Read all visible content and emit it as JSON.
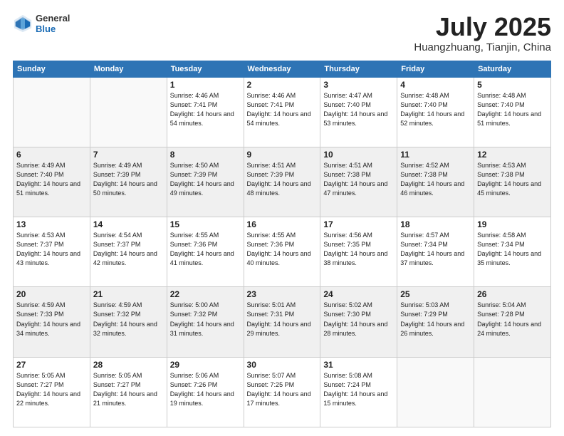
{
  "logo": {
    "general": "General",
    "blue": "Blue"
  },
  "title": {
    "month": "July 2025",
    "location": "Huangzhuang, Tianjin, China"
  },
  "weekdays": [
    "Sunday",
    "Monday",
    "Tuesday",
    "Wednesday",
    "Thursday",
    "Friday",
    "Saturday"
  ],
  "weeks": [
    [
      {
        "day": "",
        "info": ""
      },
      {
        "day": "",
        "info": ""
      },
      {
        "day": "1",
        "info": "Sunrise: 4:46 AM\nSunset: 7:41 PM\nDaylight: 14 hours and 54 minutes."
      },
      {
        "day": "2",
        "info": "Sunrise: 4:46 AM\nSunset: 7:41 PM\nDaylight: 14 hours and 54 minutes."
      },
      {
        "day": "3",
        "info": "Sunrise: 4:47 AM\nSunset: 7:40 PM\nDaylight: 14 hours and 53 minutes."
      },
      {
        "day": "4",
        "info": "Sunrise: 4:48 AM\nSunset: 7:40 PM\nDaylight: 14 hours and 52 minutes."
      },
      {
        "day": "5",
        "info": "Sunrise: 4:48 AM\nSunset: 7:40 PM\nDaylight: 14 hours and 51 minutes."
      }
    ],
    [
      {
        "day": "6",
        "info": "Sunrise: 4:49 AM\nSunset: 7:40 PM\nDaylight: 14 hours and 51 minutes."
      },
      {
        "day": "7",
        "info": "Sunrise: 4:49 AM\nSunset: 7:39 PM\nDaylight: 14 hours and 50 minutes."
      },
      {
        "day": "8",
        "info": "Sunrise: 4:50 AM\nSunset: 7:39 PM\nDaylight: 14 hours and 49 minutes."
      },
      {
        "day": "9",
        "info": "Sunrise: 4:51 AM\nSunset: 7:39 PM\nDaylight: 14 hours and 48 minutes."
      },
      {
        "day": "10",
        "info": "Sunrise: 4:51 AM\nSunset: 7:38 PM\nDaylight: 14 hours and 47 minutes."
      },
      {
        "day": "11",
        "info": "Sunrise: 4:52 AM\nSunset: 7:38 PM\nDaylight: 14 hours and 46 minutes."
      },
      {
        "day": "12",
        "info": "Sunrise: 4:53 AM\nSunset: 7:38 PM\nDaylight: 14 hours and 45 minutes."
      }
    ],
    [
      {
        "day": "13",
        "info": "Sunrise: 4:53 AM\nSunset: 7:37 PM\nDaylight: 14 hours and 43 minutes."
      },
      {
        "day": "14",
        "info": "Sunrise: 4:54 AM\nSunset: 7:37 PM\nDaylight: 14 hours and 42 minutes."
      },
      {
        "day": "15",
        "info": "Sunrise: 4:55 AM\nSunset: 7:36 PM\nDaylight: 14 hours and 41 minutes."
      },
      {
        "day": "16",
        "info": "Sunrise: 4:55 AM\nSunset: 7:36 PM\nDaylight: 14 hours and 40 minutes."
      },
      {
        "day": "17",
        "info": "Sunrise: 4:56 AM\nSunset: 7:35 PM\nDaylight: 14 hours and 38 minutes."
      },
      {
        "day": "18",
        "info": "Sunrise: 4:57 AM\nSunset: 7:34 PM\nDaylight: 14 hours and 37 minutes."
      },
      {
        "day": "19",
        "info": "Sunrise: 4:58 AM\nSunset: 7:34 PM\nDaylight: 14 hours and 35 minutes."
      }
    ],
    [
      {
        "day": "20",
        "info": "Sunrise: 4:59 AM\nSunset: 7:33 PM\nDaylight: 14 hours and 34 minutes."
      },
      {
        "day": "21",
        "info": "Sunrise: 4:59 AM\nSunset: 7:32 PM\nDaylight: 14 hours and 32 minutes."
      },
      {
        "day": "22",
        "info": "Sunrise: 5:00 AM\nSunset: 7:32 PM\nDaylight: 14 hours and 31 minutes."
      },
      {
        "day": "23",
        "info": "Sunrise: 5:01 AM\nSunset: 7:31 PM\nDaylight: 14 hours and 29 minutes."
      },
      {
        "day": "24",
        "info": "Sunrise: 5:02 AM\nSunset: 7:30 PM\nDaylight: 14 hours and 28 minutes."
      },
      {
        "day": "25",
        "info": "Sunrise: 5:03 AM\nSunset: 7:29 PM\nDaylight: 14 hours and 26 minutes."
      },
      {
        "day": "26",
        "info": "Sunrise: 5:04 AM\nSunset: 7:28 PM\nDaylight: 14 hours and 24 minutes."
      }
    ],
    [
      {
        "day": "27",
        "info": "Sunrise: 5:05 AM\nSunset: 7:27 PM\nDaylight: 14 hours and 22 minutes."
      },
      {
        "day": "28",
        "info": "Sunrise: 5:05 AM\nSunset: 7:27 PM\nDaylight: 14 hours and 21 minutes."
      },
      {
        "day": "29",
        "info": "Sunrise: 5:06 AM\nSunset: 7:26 PM\nDaylight: 14 hours and 19 minutes."
      },
      {
        "day": "30",
        "info": "Sunrise: 5:07 AM\nSunset: 7:25 PM\nDaylight: 14 hours and 17 minutes."
      },
      {
        "day": "31",
        "info": "Sunrise: 5:08 AM\nSunset: 7:24 PM\nDaylight: 14 hours and 15 minutes."
      },
      {
        "day": "",
        "info": ""
      },
      {
        "day": "",
        "info": ""
      }
    ]
  ]
}
